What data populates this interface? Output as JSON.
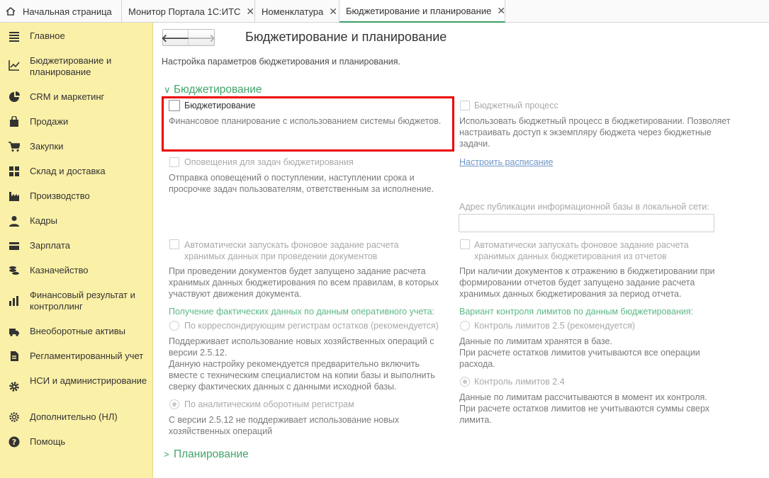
{
  "tabs": [
    {
      "label": "Начальная страница",
      "close": ""
    },
    {
      "label": "Монитор Портала 1С:ИТС",
      "close": "✕"
    },
    {
      "label": "Номенклатура",
      "close": "✕"
    },
    {
      "label": "Бюджетирование и планирование",
      "close": "✕"
    }
  ],
  "sidebar": {
    "items": [
      {
        "label": "Главное",
        "icon": "menu-lines-icon"
      },
      {
        "label": "Бюджетирование и планирование",
        "icon": "budget-chart-icon"
      },
      {
        "label": "CRM и маркетинг",
        "icon": "pie-chart-icon"
      },
      {
        "label": "Продажи",
        "icon": "shopping-bag-icon"
      },
      {
        "label": "Закупки",
        "icon": "cart-icon"
      },
      {
        "label": "Склад и доставка",
        "icon": "warehouse-grid-icon"
      },
      {
        "label": "Производство",
        "icon": "factory-icon"
      },
      {
        "label": "Кадры",
        "icon": "person-icon"
      },
      {
        "label": "Зарплата",
        "icon": "wallet-icon"
      },
      {
        "label": "Казначейство",
        "icon": "coins-icon"
      },
      {
        "label": "Финансовый результат и контроллинг",
        "icon": "bar-chart-icon"
      },
      {
        "label": "Внеоборотные активы",
        "icon": "truck-icon"
      },
      {
        "label": "Регламентированный учет",
        "icon": "document-icon"
      },
      {
        "label": "НСИ и администрирование",
        "icon": "gear-icon"
      },
      {
        "label": "Дополнительно (НЛ)",
        "icon": "settings-gear-icon"
      },
      {
        "label": "Помощь",
        "icon": "help-icon"
      }
    ]
  },
  "main": {
    "title": "Бюджетирование и планирование",
    "subtitle": "Настройка параметров бюджетирования и планирования.",
    "back": "🡐",
    "forward": "🡒",
    "group_budgeting": "Бюджетирование",
    "group_planning": "Планирование",
    "left": {
      "budgeting_label": "Бюджетирование",
      "budgeting_desc": "Финансовое планирование с использованием системы бюджетов.",
      "alerts_label": "Оповещения для задач бюджетирования",
      "alerts_desc_1": "Отправка оповещений о поступлении, наступлении срока и",
      "alerts_desc_2": "просрочке задач пользователям, ответственным за исполнение.",
      "auto_label_1": "Автоматически запускать фоновое задание расчета",
      "auto_label_2": "хранимых данных при проведении документов",
      "auto_desc_1": "При проведении документов будет запущено задание расчета",
      "auto_desc_2": "хранимых данных бюджетирования по всем правилам, в которых",
      "auto_desc_3": "участвуют движения документа.",
      "fact_header": "Получение фактических данных по данным оперативного учета:",
      "radio1_label": "По корреспондирующим регистрам остатков (рекомендуется)",
      "radio1_desc_1": "Поддерживает использование новых хозяйственных операций с",
      "radio1_desc_2": "версии 2.5.12.",
      "radio1_desc_3": "Данную настройку рекомендуется предварительно включить",
      "radio1_desc_4": "вместе с техническим специалистом на копии базы и выполнить",
      "radio1_desc_5": "сверку фактических данных с данными исходной базы.",
      "radio2_label": "По аналитическим оборотным регистрам",
      "radio2_desc_1": "С версии 2.5.12 не поддерживает использование новых",
      "radio2_desc_2": "хозяйственных операций"
    },
    "right": {
      "process_label": "Бюджетный процесс",
      "process_desc_1": "Использовать бюджетный процесс в бюджетировании. Позволяет",
      "process_desc_2": "настраивать доступ к экземпляру бюджета через бюджетные",
      "process_desc_3": "задачи.",
      "schedule_link": "Настроить расписание",
      "address_label": "Адрес публикации информационной базы в локальной сети:",
      "address_value": "",
      "auto_label_1": "Автоматически запускать фоновое задание расчета",
      "auto_label_2": "хранимых данных бюджетирования из отчетов",
      "auto_desc_1": "При наличии документов к отражению в бюджетировании при",
      "auto_desc_2": "формировании отчетов будет запущено задание расчета",
      "auto_desc_3": "хранимых данных бюджетирования за период отчета.",
      "limits_header": "Вариант контроля лимитов по данным бюджетирования:",
      "radio1_label": "Контроль лимитов 2.5 (рекомендуется)",
      "radio1_desc_1": "Данные по лимитам хранятся в базе.",
      "radio1_desc_2": "При расчете остатков лимитов учитываются все операции",
      "radio1_desc_3": "расхода.",
      "radio2_label": "Контроль лимитов 2.4",
      "radio2_desc_1": "Данные по лимитам рассчитываются в момент их контроля.",
      "radio2_desc_2": "При расчете остатков лимитов не учитываются суммы сверх",
      "radio2_desc_3": "лимита."
    }
  },
  "colors": {
    "accent_green": "#3fa56a",
    "sidebar_bg": "#fbf0a8",
    "highlight_red": "#ec0000",
    "link_blue": "#6f95c8"
  }
}
